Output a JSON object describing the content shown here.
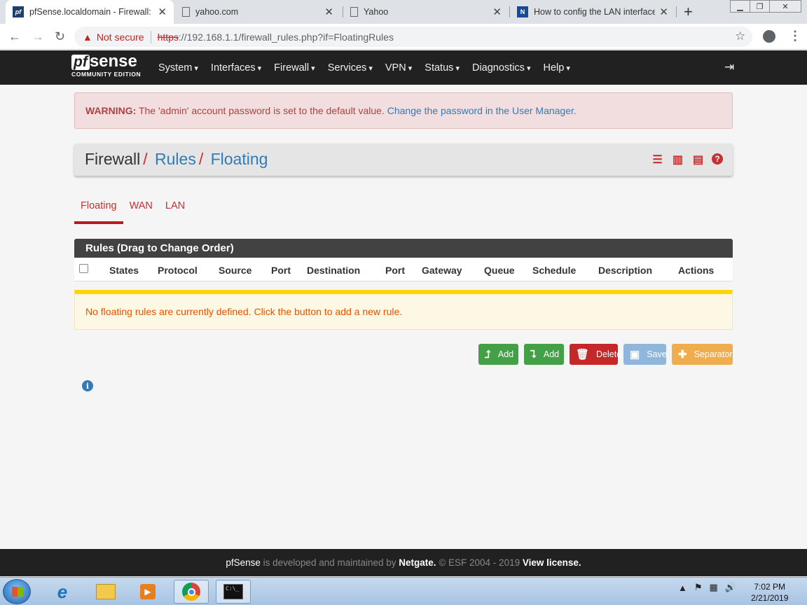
{
  "browser": {
    "tabs": [
      {
        "title": "pfSense.localdomain - Firewall: R",
        "active": true
      },
      {
        "title": "yahoo.com"
      },
      {
        "title": "Yahoo"
      },
      {
        "title": "How to config the LAN interface"
      }
    ],
    "security_label": "Not secure",
    "url_scheme": "https",
    "url_rest": "://192.168.1.1/firewall_rules.php?if=FloatingRules"
  },
  "nav": {
    "logo_main": "sense",
    "logo_pf": "pf",
    "logo_sub": "COMMUNITY EDITION",
    "items": [
      "System",
      "Interfaces",
      "Firewall",
      "Services",
      "VPN",
      "Status",
      "Diagnostics",
      "Help"
    ]
  },
  "alert": {
    "label": "WARNING:",
    "text": "The 'admin' account password is set to the default value.",
    "link": "Change the password in the User Manager."
  },
  "breadcrumb": {
    "root": "Firewall",
    "level2": "Rules",
    "level3": "Floating"
  },
  "tabs": [
    "Floating",
    "WAN",
    "LAN"
  ],
  "table": {
    "title": "Rules (Drag to Change Order)",
    "columns": [
      "States",
      "Protocol",
      "Source",
      "Port",
      "Destination",
      "Port",
      "Gateway",
      "Queue",
      "Schedule",
      "Description",
      "Actions"
    ],
    "empty_message": "No floating rules are currently defined. Click the button to add a new rule."
  },
  "buttons": {
    "add_top": "Add",
    "add_bottom": "Add",
    "delete": "Delete",
    "save": "Save",
    "separator": "Separator"
  },
  "footer": {
    "product": "pfSense",
    "text1": "is developed and maintained by",
    "company": "Netgate.",
    "text2": "© ESF 2004 - 2019",
    "license": "View license."
  },
  "taskbar": {
    "time": "7:02 PM",
    "date": "2/21/2019"
  }
}
